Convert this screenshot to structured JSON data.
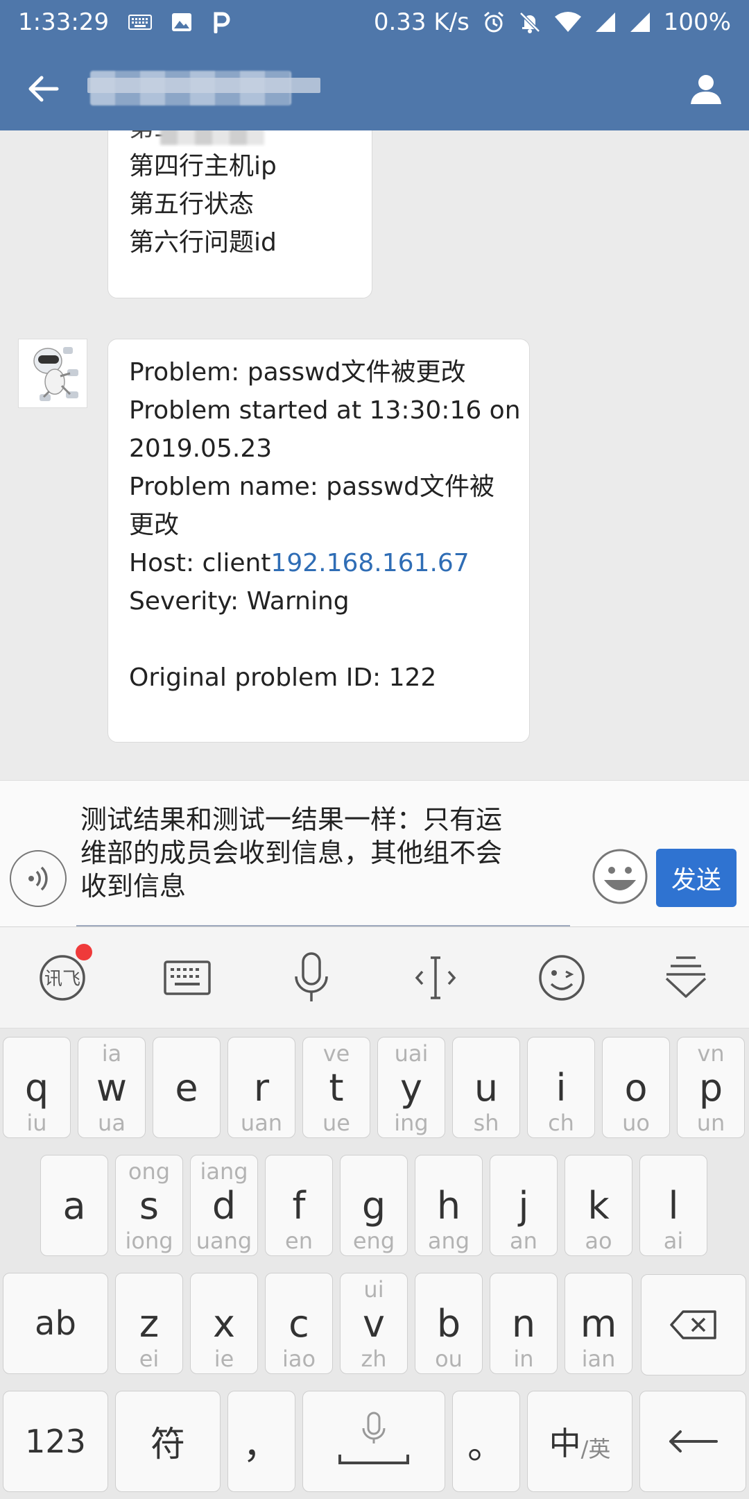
{
  "status_bar": {
    "time": "1:33:29",
    "network_speed": "0.33 K/s",
    "battery": "100%",
    "icons": [
      "keyboard-icon",
      "image-icon",
      "p-app-icon",
      "alarm-icon",
      "mute-icon",
      "wifi-icon",
      "signal-icon",
      "signal-icon-2"
    ]
  },
  "app_bar": {
    "back_icon": "arrow-left-icon",
    "profile_icon": "person-icon"
  },
  "messages": [
    {
      "sender": "self-other",
      "lines": [
        "第四行主机ip",
        "第五行状态",
        "第六行问题id"
      ],
      "partial_line": "第三行问题"
    },
    {
      "sender": "bot",
      "line1": "Problem: passwd文件被更改",
      "line2": "Problem started at 13:30:16 on",
      "line3": "2019.05.23",
      "line4": "Problem name: passwd文件被",
      "line5": "更改",
      "host_prefix": "Host: client",
      "host_ip": "192.168.161.67",
      "line7": "Severity: Warning",
      "line8": "Original problem ID: 122"
    }
  ],
  "input": {
    "text": "测试结果和测试一结果一样：只有运\n维部的成员会收到信息，其他组不会\n收到信息",
    "send_label": "发送"
  },
  "ime_toolbar": {
    "tools": [
      "xunfei-logo-icon",
      "keyboard-icon",
      "microphone-icon",
      "cursor-icon",
      "emoji-icon",
      "collapse-icon"
    ]
  },
  "keyboard": {
    "row1": [
      {
        "main": "q",
        "top": "",
        "bot": "iu"
      },
      {
        "main": "w",
        "top": "ia",
        "bot": "ua"
      },
      {
        "main": "e",
        "top": "",
        "bot": ""
      },
      {
        "main": "r",
        "top": "",
        "bot": "uan"
      },
      {
        "main": "t",
        "top": "ve",
        "bot": "ue"
      },
      {
        "main": "y",
        "top": "uai",
        "bot": "ing"
      },
      {
        "main": "u",
        "top": "",
        "bot": "sh"
      },
      {
        "main": "i",
        "top": "",
        "bot": "ch"
      },
      {
        "main": "o",
        "top": "",
        "bot": "uo"
      },
      {
        "main": "p",
        "top": "vn",
        "bot": "un"
      }
    ],
    "row2": [
      {
        "main": "a",
        "top": "",
        "bot": ""
      },
      {
        "main": "s",
        "top": "ong",
        "bot": "iong"
      },
      {
        "main": "d",
        "top": "iang",
        "bot": "uang"
      },
      {
        "main": "f",
        "top": "",
        "bot": "en"
      },
      {
        "main": "g",
        "top": "",
        "bot": "eng"
      },
      {
        "main": "h",
        "top": "",
        "bot": "ang"
      },
      {
        "main": "j",
        "top": "",
        "bot": "an"
      },
      {
        "main": "k",
        "top": "",
        "bot": "ao"
      },
      {
        "main": "l",
        "top": "",
        "bot": "ai"
      }
    ],
    "row3": [
      {
        "main": "ab",
        "top": "",
        "bot": ""
      },
      {
        "main": "z",
        "top": "",
        "bot": "ei"
      },
      {
        "main": "x",
        "top": "",
        "bot": "ie"
      },
      {
        "main": "c",
        "top": "",
        "bot": "iao"
      },
      {
        "main": "v",
        "top": "ui",
        "bot": "zh"
      },
      {
        "main": "b",
        "top": "",
        "bot": "ou"
      },
      {
        "main": "n",
        "top": "",
        "bot": "in"
      },
      {
        "main": "m",
        "top": "",
        "bot": "ian"
      }
    ],
    "row4": {
      "num_label": "123",
      "symbol_label": "符",
      "comma_label": "，",
      "period_label": "。",
      "lang_main": "中",
      "lang_sub": "/英"
    }
  }
}
